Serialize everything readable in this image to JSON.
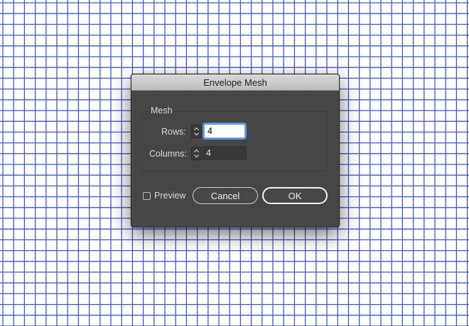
{
  "background": {
    "grid_line_color": "#3f57c7",
    "page_color": "#ffffff"
  },
  "dialog": {
    "title": "Envelope Mesh",
    "group_label": "Mesh",
    "rows": {
      "label": "Rows:",
      "value": "4",
      "focused": true
    },
    "columns": {
      "label": "Columns:",
      "value": "4",
      "focused": false
    },
    "preview": {
      "label": "Preview",
      "checked": false
    },
    "buttons": {
      "cancel": "Cancel",
      "ok": "OK"
    }
  },
  "icons": {
    "stepper": "up-down-stepper-icon"
  }
}
